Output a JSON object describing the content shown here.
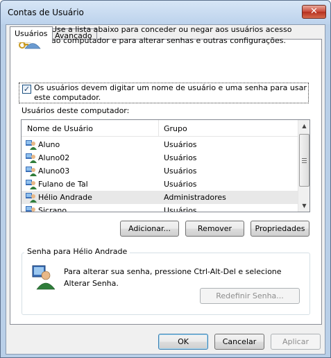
{
  "window": {
    "title": "Contas de Usuário",
    "close_label": "✕"
  },
  "tabs": [
    {
      "label": "Usuários"
    },
    {
      "label": "Avançado"
    }
  ],
  "intro": {
    "text": "Use a lista abaixo para conceder ou negar aos usuários acesso ao computador e para alterar senhas e outras configurações."
  },
  "require_login": {
    "checked_glyph": "✓",
    "label": "Os usuários devem digitar um nome de usuário e uma senha para usar este computador."
  },
  "users_list": {
    "label": "Usuários deste computador:",
    "columns": [
      "Nome de Usuário",
      "Grupo"
    ],
    "rows": [
      {
        "name": "Aluno",
        "group": "Usuários"
      },
      {
        "name": "Aluno02",
        "group": "Usuários"
      },
      {
        "name": "Aluno03",
        "group": "Usuários"
      },
      {
        "name": "Fulano de Tal",
        "group": "Usuários"
      },
      {
        "name": "Hélio Andrade",
        "group": "Administradores"
      },
      {
        "name": "Sicrano",
        "group": "Usuários"
      }
    ],
    "selected_index": 4,
    "scroll_up": "▲",
    "scroll_down": "▼"
  },
  "list_buttons": {
    "add": "Adicionar...",
    "remove": "Remover",
    "properties": "Propriedades"
  },
  "password_group": {
    "title": "Senha para Hélio Andrade",
    "text": "Para alterar sua senha, pressione Ctrl-Alt-Del e selecione Alterar Senha.",
    "reset_button": "Redefinir Senha..."
  },
  "dialog_buttons": {
    "ok": "OK",
    "cancel": "Cancelar",
    "apply": "Aplicar"
  },
  "icons": {
    "users": "users-icon",
    "user_row": "user-icon",
    "password": "user-key-icon"
  }
}
